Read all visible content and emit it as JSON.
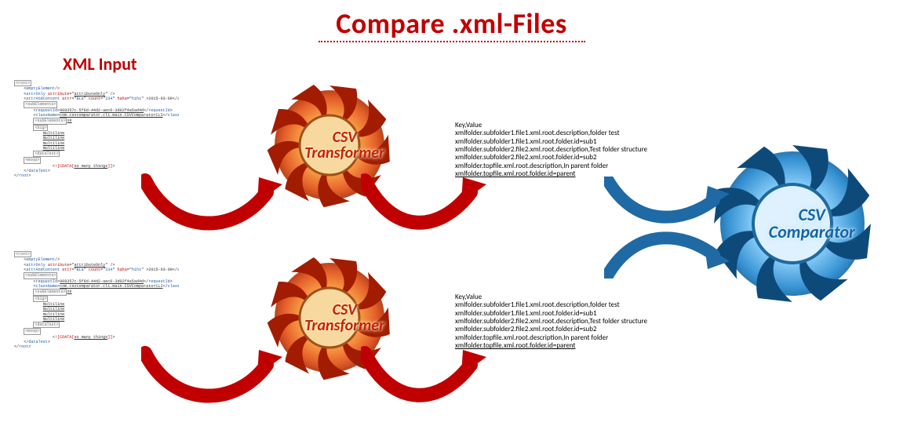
{
  "title": "Compare .xml-Files",
  "subtitle": "XML Input",
  "transformer_label_1": "CSV",
  "transformer_label_2": "Transformer",
  "comparator_label_1": "CSV",
  "comparator_label_2": "Comparator",
  "kv_header": "Key,Value",
  "kv": {
    "l1": "xmlfolder.subfolder1.file1.xml.root.description,folder test",
    "l2": "xmlfolder.subfolder1.file1.xml.root.folder.id=sub1",
    "l3": "xmlfolder.subfolder2.file2.xml.root.description,Test folder structure",
    "l4": "xmlfolder.subfolder2.file2.xml.root.folder.id=sub2",
    "l5": "xmlfolder.topfile.xml.root.description,In parent folder",
    "l6": "xmlfolder.topfile.xml.root.folder.id=parent"
  },
  "xml": {
    "boxRoot": "root",
    "emptyElement": "emptyElement",
    "attrOnly": "attrOnly",
    "attribute": "attribute",
    "attributeOnlyVal": "attributeOnly",
    "attrAndContent": "attrAndContent",
    "attrAndContentClose": "attrAndContent",
    "attrVal": "BLa",
    "count": "count",
    "countVal": "234",
    "haha": "haha",
    "hahaVal": "hihi",
    "date": "2015-03-09",
    "subElements": "subElements",
    "requestId": "requestId",
    "guid": "908357c-5f8d-44d2-aec0-3d02f4a5ad4d",
    "className": "className",
    "classNameVal": "com.csvcomparator.cli.main.CSVComparatorCLI",
    "subElements2": "subElements",
    "ok": "ok",
    "big": "big",
    "multiline": "multiline",
    "dataTest": "dataTest",
    "moop": "moop",
    "soMany": "so many things",
    "cdata": "![CDATA[",
    "cdataEnd": "]]"
  }
}
